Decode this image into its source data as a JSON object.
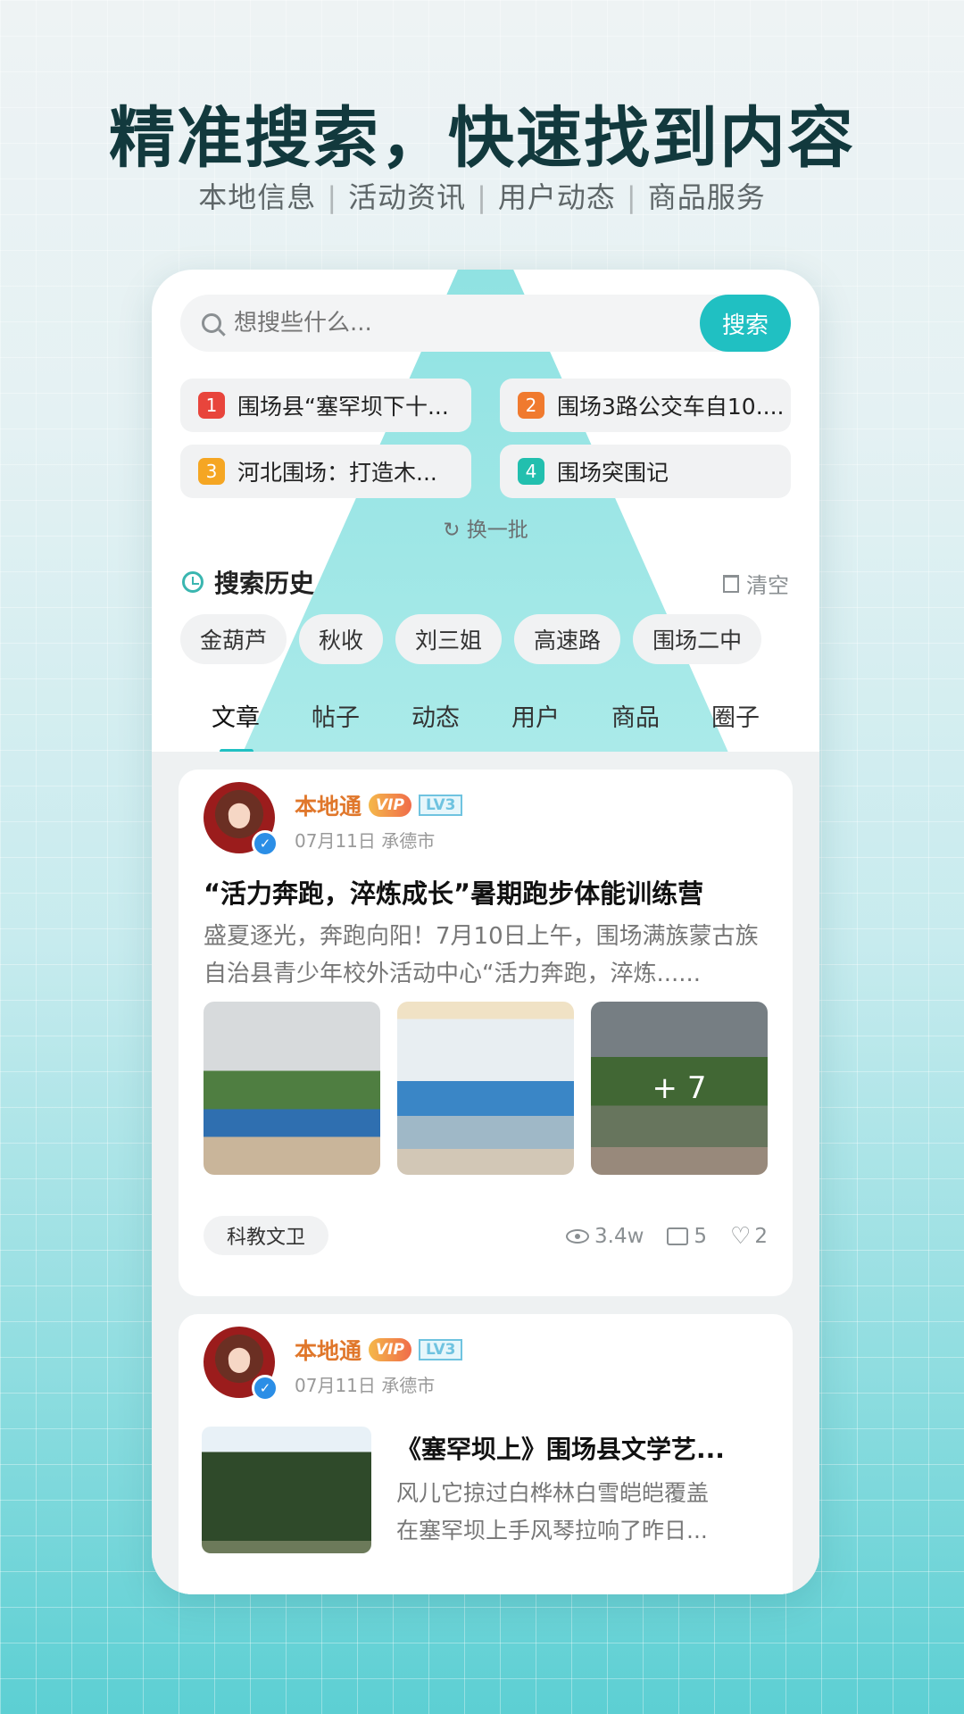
{
  "headline": "精准搜索，快速找到内容",
  "subline": {
    "items": [
      "本地信息",
      "活动资讯",
      "用户动态",
      "商品服务"
    ],
    "separator": "|"
  },
  "search": {
    "placeholder": "想搜些什么...",
    "button": "搜索"
  },
  "hot": [
    {
      "rank": "1",
      "text": "围场县“塞罕坝下十...",
      "color": "#e8453c"
    },
    {
      "rank": "2",
      "text": "围场3路公交车自10....",
      "color": "#f07a2e"
    },
    {
      "rank": "3",
      "text": "河北围场：打造木...",
      "color": "#f5a623"
    },
    {
      "rank": "4",
      "text": "围场突围记",
      "color": "#22bfae"
    }
  ],
  "refresh": "换一批",
  "history": {
    "title": "搜索历史",
    "clear": "清空",
    "items": [
      "金葫芦",
      "秋收",
      "刘三姐",
      "高速路",
      "围场二中"
    ]
  },
  "tabs": [
    "文章",
    "帖子",
    "动态",
    "用户",
    "商品",
    "圈子"
  ],
  "card1": {
    "author": "本地通",
    "vip": "VIP",
    "level": "LV3",
    "meta": "07月11日  承德市",
    "title": "“活力奔跑，淬炼成长”暑期跑步体能训练营",
    "body": "盛夏逐光，奔跑向阳！7月10日上午，围场满族蒙古族自治县青少年校外活动中心“活力奔跑，淬炼......",
    "more_images": "+ 7",
    "tag": "科教文卫",
    "views": "3.4w",
    "comments": "5",
    "likes": "2"
  },
  "card2": {
    "author": "本地通",
    "vip": "VIP",
    "level": "LV3",
    "meta": "07月11日  承德市",
    "title": "《塞罕坝上》围场县文学艺...",
    "line1": "风儿它掠过白桦林白雪皑皑覆盖",
    "line2": "在塞罕坝上手风琴拉响了昨日..."
  },
  "colors": {
    "accent": "#20c0c2",
    "author": "#e0772b"
  }
}
